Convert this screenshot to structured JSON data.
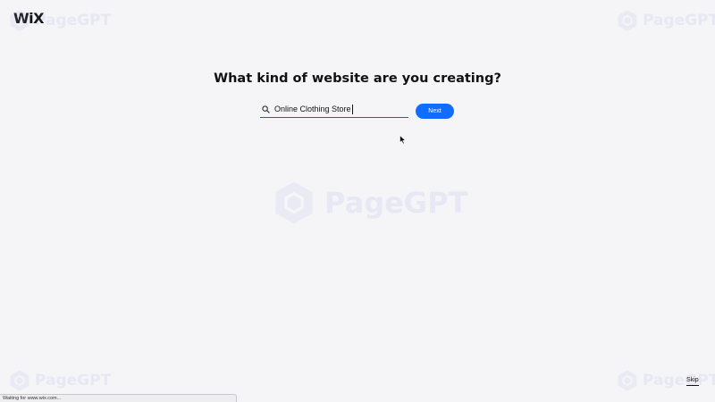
{
  "brand": {
    "logo_text": "WiX"
  },
  "watermark": {
    "text": "PageGPT"
  },
  "onboarding": {
    "question": "What kind of website are you creating?",
    "search_value": "Online Clothing Store",
    "next_label": "Next",
    "skip_label": "Skip"
  },
  "status_bar": {
    "text": "Waiting for www.wix.com..."
  },
  "icons": {
    "search": "search-icon",
    "cursor": "mouse-pointer-icon",
    "watermark": "hexagon-logo-icon"
  },
  "colors": {
    "background": "#f5f5f7",
    "accent": "#116dff",
    "input_underline": "#1f5bd6",
    "text": "#111111"
  }
}
